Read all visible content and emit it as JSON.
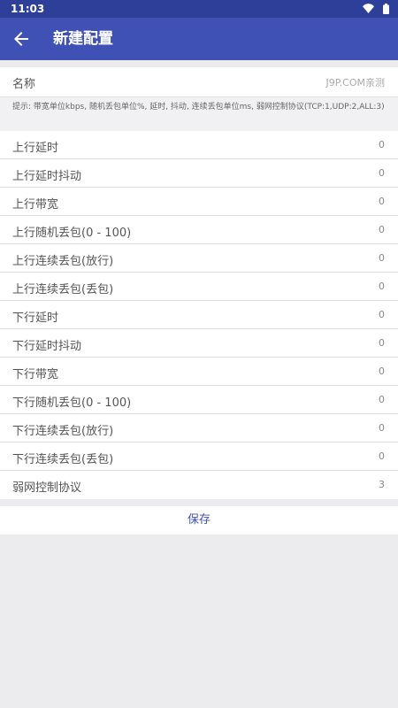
{
  "status_bar": {
    "time": "11:03",
    "icons": [
      "wifi-icon",
      "battery-icon"
    ]
  },
  "app_bar": {
    "title": "新建配置",
    "back_icon": "arrow-back-icon"
  },
  "name_field": {
    "label": "名称",
    "value": "J9P.COM亲测"
  },
  "hint": "提示: 带宽单位kbps, 随机丢包单位%, 延时, 抖动, 连续丢包单位ms, 弱网控制协议(TCP:1,UDP:2,ALL:3)",
  "rows": [
    {
      "label": "上行延时",
      "value": "0"
    },
    {
      "label": "上行延时抖动",
      "value": "0"
    },
    {
      "label": "上行带宽",
      "value": "0"
    },
    {
      "label": "上行随机丢包(0 - 100)",
      "value": "0"
    },
    {
      "label": "上行连续丢包(放行)",
      "value": "0"
    },
    {
      "label": "上行连续丢包(丢包)",
      "value": "0"
    },
    {
      "label": "下行延时",
      "value": "0"
    },
    {
      "label": "下行延时抖动",
      "value": "0"
    },
    {
      "label": "下行带宽",
      "value": "0"
    },
    {
      "label": "下行随机丢包(0 - 100)",
      "value": "0"
    },
    {
      "label": "下行连续丢包(放行)",
      "value": "0"
    },
    {
      "label": "下行连续丢包(丢包)",
      "value": "0"
    },
    {
      "label": "弱网控制协议",
      "value": "3"
    }
  ],
  "save_label": "保存",
  "colors": {
    "primary": "#3F51B5",
    "status_bar": "#2E3F9A",
    "background": "#ECECEF"
  }
}
